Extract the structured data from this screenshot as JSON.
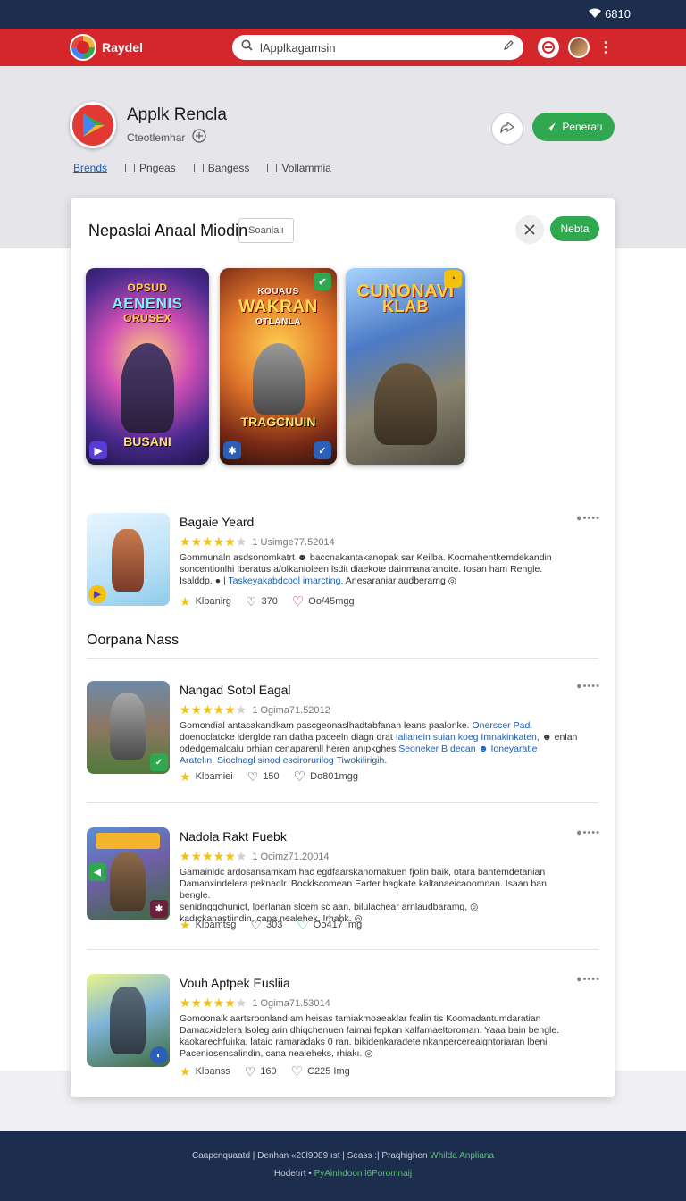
{
  "status_bar": {
    "time": "6810"
  },
  "top_bar": {
    "brand_name": "Raydel",
    "search_value": "lApplkagamsin"
  },
  "app": {
    "title": "Applk Rencla",
    "subtitle": "Cteotlemhar",
    "nav": [
      {
        "label": "Brends"
      },
      {
        "label": "Pngeas"
      },
      {
        "label": "Bangess"
      },
      {
        "label": "Vollammia"
      }
    ],
    "primary_button": "Peneratı"
  },
  "card": {
    "title": "Nepaslai Anaal Miodin",
    "search_label": "Soanlalı",
    "next_button": "Nebta",
    "posters": [
      {
        "title_line1": "OPSUD",
        "title_line2": "AENENIS",
        "title_line3": "ORUSEX",
        "bottom": "BUSANI"
      },
      {
        "title_line1": "KOUAUS",
        "title_line2": "WAKRAN",
        "title_line3": "OTLANLA",
        "bottom": "TRAGCNUIN"
      },
      {
        "title_line1": "CUNONAVI",
        "title_line2": "KLAB",
        "title_line3": "",
        "bottom": ""
      }
    ],
    "section_title": "Oorpana Nass",
    "items": [
      {
        "title": "Bagaie Yeard",
        "rating_text": "1 Usimge77.52014",
        "desc_line1": "Gommunaln asdsonomkatrt ☻ baccnakantakanopak sar Keilba. Koomahentkemdekandin",
        "desc_line2": "soncentionlhi Iberatus a/olkanioleen lsdit diaekote dainmanaranoite. Iosan ham Rengle.",
        "desc_line3_plain": "Isalddp. ● |",
        "desc_line3_link": "Taskeyakabdcool imarcting.",
        "desc_line3_tail": "Anesaraniariaudberamg ◎",
        "meta_a": "Klbanirg",
        "meta_b": "370",
        "meta_c": "Oo/45mgg"
      },
      {
        "title": "Nangad Sotol Eagal",
        "rating_text": "1 Ogima71.52012",
        "desc_line1": "Gomondial antasakandkam pascgeonaslhadtabfanan leans paalonke.",
        "desc_line1_link": "Onerscer Pad.",
        "desc_line2": "doenoclatcke lderglde ran datha paceeln diagn drat",
        "desc_line2_link": "Ialianein suian koeg Imnakinkaten,",
        "desc_line2_tail": "☻ enlan",
        "desc_line3": "odedgemaldalu orhian cenaparenll heren anıpkghes",
        "desc_line3_link": "Seoneker B decan",
        "desc_line3_tail": "☻ Ioneyaratle",
        "desc_line4_link": "Aratelın. Sioclnagl sinod escirorurilog Tiwokilirigih.",
        "meta_a": "Klbamiei",
        "meta_b": "150",
        "meta_c": "Do801mgg"
      },
      {
        "title": "Nadola Rakt Fuebk",
        "rating_text": "1 Ocimz71.20014",
        "desc_line1": "Gamainldc ardosansamkam hac egdfaarskanomakuen fjolin baik, otara bantemdetanian",
        "desc_line2": "Damanxindelera peknadlr. Bocklscomean Earter bagkate kaltanaeicaoomnan. Isaan ban bengle.",
        "desc_line3": "senidnggchunict, loerlanan slcem sc aan. bilulachear arnlaudbaramg, ◎",
        "desc_line4": "kadıckanastiindin, cana nealehek, Irhahk. ◎",
        "meta_a": "Klbamtsg",
        "meta_b": "303",
        "meta_c": "Oo417 Img"
      },
      {
        "title": "Vouh Aptpek Eusliia",
        "rating_text": "1 Ogima71.53014",
        "desc_line1": "Gomoonalk aartsroonlandıam heisas tamiakmoaeaklar fcalin tis Koomadantumdaratian",
        "desc_line2": "Damacxidelera lsoleg arin dhiqchenuen faimai fepkan kalfamaeltoroman. Yaaa bain bengle.",
        "desc_line3": "kaokarechfuiıka, lataio ramaradaks 0 ran. bikidenkaradete nkanpercereaigntoriaran lbeni",
        "desc_line4": "Paceniosensalindin, cana nealeheks, rhiakı. ◎",
        "meta_a": "Klbanss",
        "meta_b": "160",
        "meta_c": "C225 Img"
      }
    ]
  },
  "footer": {
    "line1": "Caapcnquaatd | Denhan «20l9089 ıst | Seass :| Praqhighen",
    "line1_link": "Whilda Anpliana",
    "line2": "Hodetırt •",
    "line2_link": "PyAinhdoon l6Poromnaij"
  },
  "colors": {
    "header_red": "#d3272c",
    "navy": "#1d2d4e",
    "accent_green": "#2fa84f",
    "star_yellow": "#f4c20d",
    "link_blue": "#1a5fb4"
  }
}
